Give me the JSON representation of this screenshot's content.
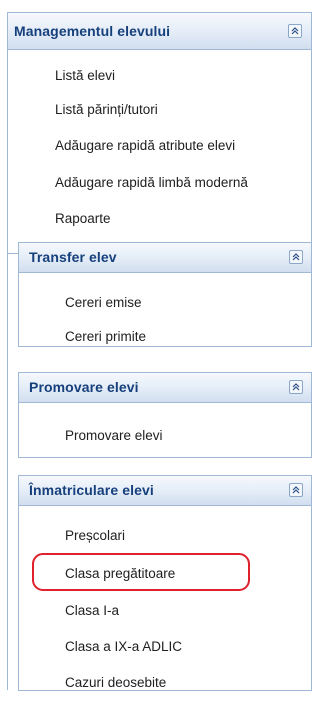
{
  "panels": {
    "management": {
      "title": "Managementul elevului",
      "items": [
        "Listă elevi",
        "Listă părinți/tutori",
        "Adăugare rapidă atribute elevi",
        "Adăugare rapidă limbă modernă",
        "Rapoarte"
      ]
    },
    "transfer": {
      "title": "Transfer elev",
      "items": [
        "Cereri emise",
        "Cereri primite"
      ]
    },
    "promovare": {
      "title": "Promovare elevi",
      "items": [
        "Promovare elevi"
      ]
    },
    "inmatriculare": {
      "title": "Înmatriculare elevi",
      "items": [
        "Preșcolari",
        "Clasa pregătitoare",
        "Clasa I-a",
        "Clasa a IX-a ADLIC",
        "Cazuri deosebite"
      ]
    }
  },
  "icons": {
    "collapse": "double-chevron-up-icon"
  },
  "colors": {
    "title": "#16407c",
    "border": "#9fb8d6",
    "highlight": "#e0202a"
  }
}
